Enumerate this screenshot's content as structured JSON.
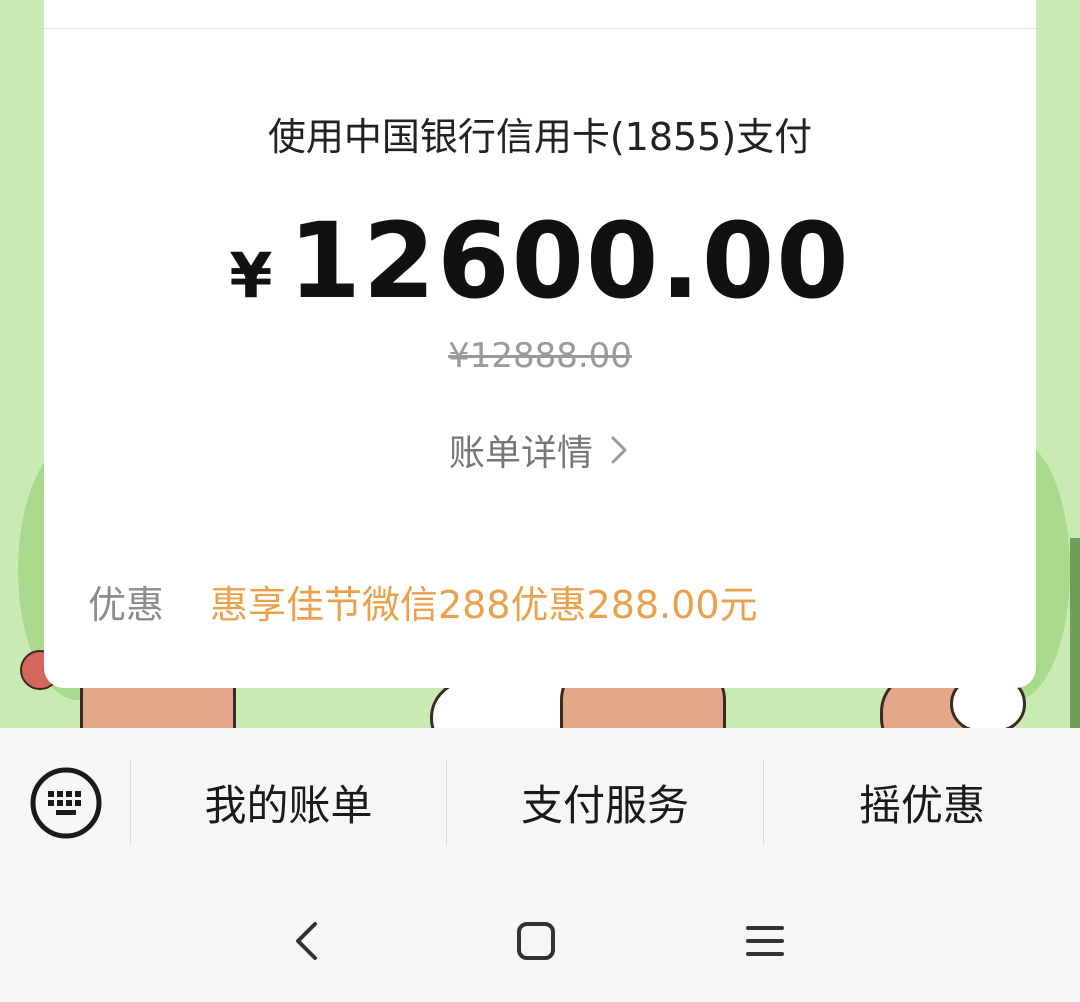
{
  "payment": {
    "method": "使用中国银行信用卡(1855)支付",
    "currency_symbol": "¥",
    "amount": "12600.00",
    "original_amount": "¥12888.00",
    "bill_detail_label": "账单详情",
    "discount_label": "优惠",
    "discount_value": "惠享佳节微信288优惠288.00元"
  },
  "menu": {
    "items": [
      "我的账单",
      "支付服务",
      "摇优惠"
    ]
  },
  "icons": {
    "keyboard": "keyboard-icon",
    "chevron": "chevron-right-icon",
    "back": "back-icon",
    "home": "home-icon",
    "recents": "recents-icon"
  },
  "colors": {
    "discount_accent": "#eba14c",
    "background_green": "#c9ebb3"
  }
}
